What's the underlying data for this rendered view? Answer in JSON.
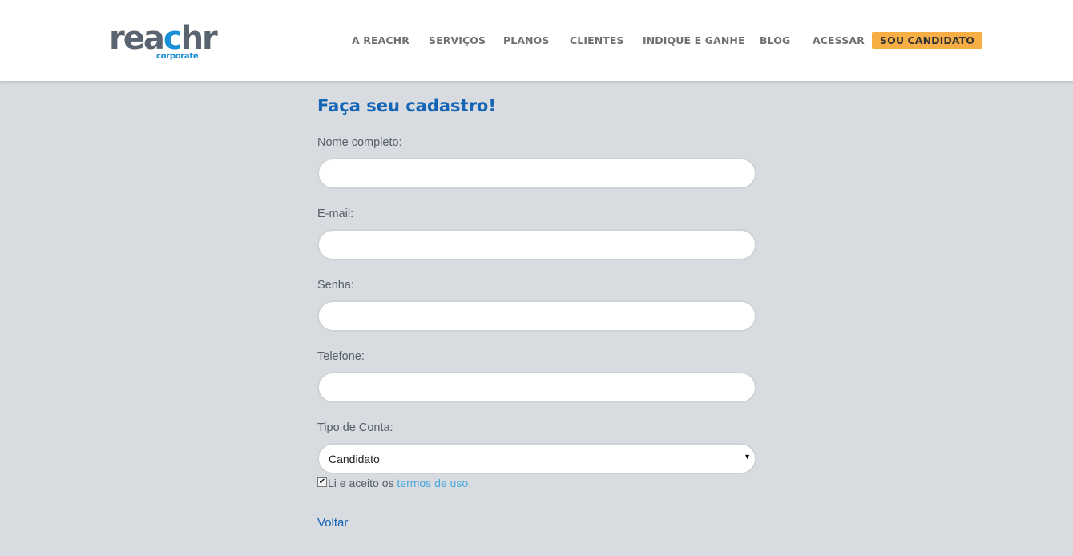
{
  "logo": {
    "word": "reachr",
    "word_a": "rea",
    "word_c": "c",
    "word_b": "hr",
    "sub": "corporate"
  },
  "nav": {
    "items": [
      {
        "label": "A REACHR"
      },
      {
        "label": "SERVIÇOS"
      },
      {
        "label": "PLANOS"
      },
      {
        "label": "CLIENTES"
      },
      {
        "label": "INDIQUE E GANHE"
      },
      {
        "label": "BLOG"
      },
      {
        "label": "ACESSAR"
      }
    ],
    "cta": "SOU CANDIDATO"
  },
  "form": {
    "title": "Faça seu cadastro!",
    "fields": [
      {
        "label": "Nome completo:",
        "value": ""
      },
      {
        "label": "E-mail:",
        "value": ""
      },
      {
        "label": "Senha:",
        "value": ""
      },
      {
        "label": "Telefone:",
        "value": ""
      }
    ],
    "account_type": {
      "label": "Tipo de Conta:",
      "selected": "Candidato"
    },
    "terms": {
      "checked": true,
      "text": "Li e aceito os ",
      "link": "termos de uso."
    },
    "back": "Voltar"
  },
  "colors": {
    "background": "#d8dbdf",
    "title_blue": "#1465b5",
    "cta_orange": "#f6ae45",
    "link_light_blue": "#4aa8de"
  },
  "icons": {
    "select_caret": "caret-down-icon",
    "checkbox": "checkmark-icon"
  }
}
